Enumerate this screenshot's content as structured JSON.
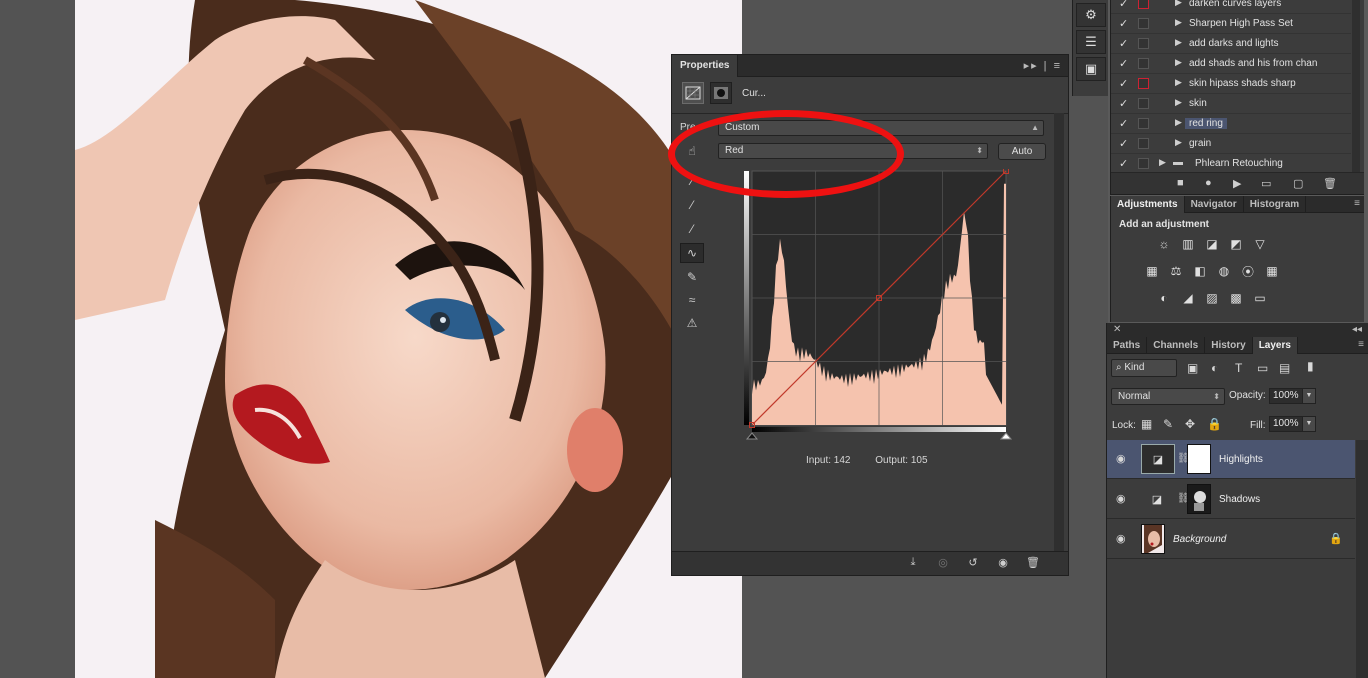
{
  "properties": {
    "tab_label": "Properties",
    "panel_controls": "▸▸ | ≡",
    "title": "Cur...",
    "preset_label": "Pre",
    "preset_value": "Custom",
    "channel_value": "Red",
    "auto_label": "Auto",
    "input_label": "Input: 142",
    "output_label": "Output: 105",
    "curve_color": "#c0392b",
    "histogram_color": "#f5c3ae"
  },
  "annotation": {
    "color": "#ee1111"
  },
  "actions": {
    "rows": [
      {
        "check": "✓",
        "label": "darken curves layers"
      },
      {
        "check": "✓",
        "label": "Sharpen High Pass Set"
      },
      {
        "check": "✓",
        "label": "add darks and lights"
      },
      {
        "check": "✓",
        "label": "add shads and his from chan"
      },
      {
        "check": "✓",
        "label": "skin hipass shads sharp"
      },
      {
        "check": "✓",
        "label": "skin"
      },
      {
        "check": "✓",
        "label": "red ring"
      },
      {
        "check": "✓",
        "label": "grain"
      },
      {
        "check": "✓",
        "label": "Phlearn Retouching"
      }
    ],
    "footer_icons": [
      "stop-icon",
      "record-icon",
      "play-icon",
      "folder-icon",
      "new-icon",
      "trash-icon"
    ]
  },
  "adjustments": {
    "tabs": [
      "Adjustments",
      "Navigator",
      "Histogram"
    ],
    "add_title": "Add an adjustment"
  },
  "layers": {
    "tabs": [
      "Paths",
      "Channels",
      "History",
      "Layers"
    ],
    "kind_label": "Kind",
    "blend_mode": "Normal",
    "opacity_label": "Opacity:",
    "opacity_value": "100%",
    "lock_label": "Lock:",
    "fill_label": "Fill:",
    "fill_value": "100%",
    "rows": [
      {
        "name": "Highlights"
      },
      {
        "name": "Shadows"
      },
      {
        "name": "Background"
      }
    ]
  }
}
